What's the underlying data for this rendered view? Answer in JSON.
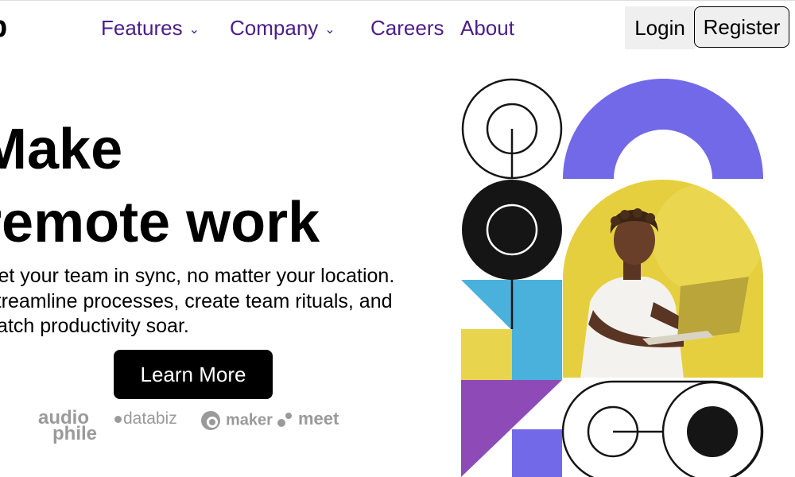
{
  "header": {
    "logo_fragment": "b",
    "nav": {
      "features": "Features",
      "company": "Company",
      "careers": "Careers",
      "about": "About"
    },
    "chevron": "⌄",
    "login_label": "Login",
    "register_label": "Register"
  },
  "hero": {
    "headline_line1": "Make",
    "headline_line2": "remote work",
    "subtext_line1": "Get your team in sync, no matter your location.",
    "subtext_line2": "Streamline processes, create team rituals, and",
    "subtext_line3": "watch productivity soar.",
    "cta_label": "Learn More"
  },
  "partners": {
    "audiophile_1": "audio",
    "audiophile_2": "phile",
    "databiz": "databiz",
    "maker": "maker",
    "meet": "meet"
  },
  "colors": {
    "nav_text": "#4b1d8a",
    "purple_arch": "#7269e8",
    "yellow": "#e8d44d",
    "blue": "#4ab0dc",
    "violet": "#8e4bb8",
    "dark": "#151515",
    "partner_gray": "#9a9a9a"
  }
}
